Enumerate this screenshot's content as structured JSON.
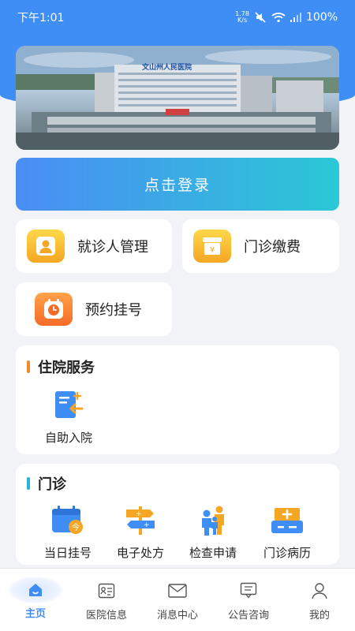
{
  "status_bar": {
    "time": "下午1:01",
    "speed_top": "1.78",
    "speed_bottom": "K/s",
    "battery": "100%"
  },
  "banner": {
    "hospital_sign": "文山州人民医院"
  },
  "login_button": "点击登录",
  "quick_actions": {
    "patient_management": "就诊人管理",
    "outpatient_payment": "门诊缴费",
    "appointment": "预约挂号"
  },
  "inpatient_section": {
    "title": "住院服务",
    "accent": "#f5882b",
    "items": [
      {
        "label": "自助入院",
        "icon": "self-admission-icon"
      }
    ]
  },
  "outpatient_section": {
    "title": "门诊",
    "accent": "#2bb3d6",
    "items": [
      {
        "label": "当日挂号",
        "icon": "calendar-icon"
      },
      {
        "label": "电子处方",
        "icon": "signpost-icon"
      },
      {
        "label": "检查申请",
        "icon": "people-icon"
      },
      {
        "label": "门诊病历",
        "icon": "medical-record-icon"
      }
    ]
  },
  "tabbar": {
    "accent": "#3f8ef5",
    "tabs": [
      {
        "label": "主页",
        "icon": "home-icon",
        "active": true
      },
      {
        "label": "医院信息",
        "icon": "info-card-icon",
        "active": false
      },
      {
        "label": "消息中心",
        "icon": "mail-icon",
        "active": false
      },
      {
        "label": "公告咨询",
        "icon": "announcement-icon",
        "active": false
      },
      {
        "label": "我的",
        "icon": "user-icon",
        "active": false
      }
    ]
  }
}
